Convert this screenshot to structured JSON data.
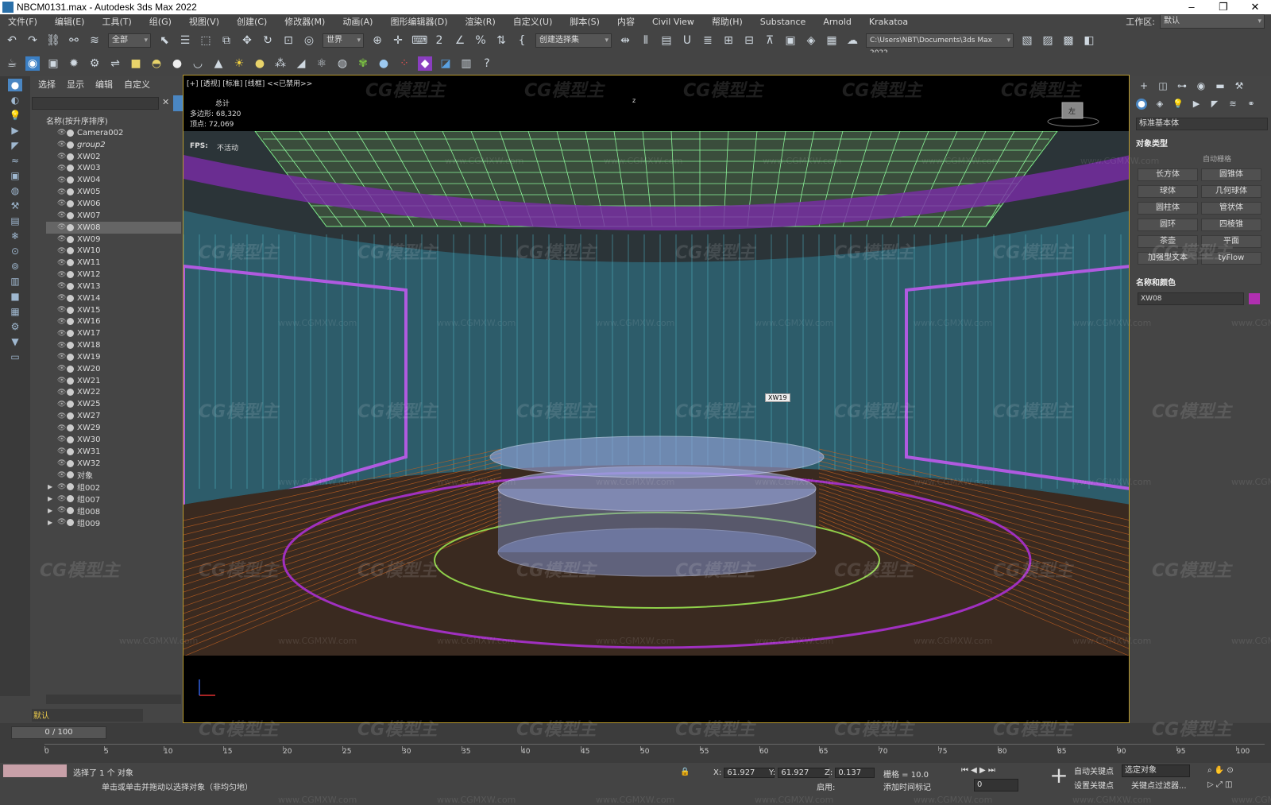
{
  "window": {
    "title": "NBCM0131.max - Autodesk 3ds Max 2022",
    "minimize": "–",
    "restore": "❐",
    "close": "✕"
  },
  "menu": {
    "items": [
      "文件(F)",
      "编辑(E)",
      "工具(T)",
      "组(G)",
      "视图(V)",
      "创建(C)",
      "修改器(M)",
      "动画(A)",
      "图形编辑器(D)",
      "渲染(R)",
      "自定义(U)",
      "脚本(S)",
      "内容",
      "Civil View",
      "帮助(H)",
      "Substance",
      "Arnold",
      "Krakatoa"
    ],
    "workspace_label": "工作区:",
    "workspace_value": "默认"
  },
  "toolbar": {
    "filter_dropdown": "全部",
    "coord_dropdown": "世界",
    "selection_set": "创建选择集",
    "project_path": "C:\\Users\\NBT\\Documents\\3ds Max 2022"
  },
  "scene_explorer": {
    "tabs": [
      "选择",
      "显示",
      "编辑",
      "自定义"
    ],
    "column_header": "名称(按升序排序)",
    "rows": [
      {
        "label": "Camera002"
      },
      {
        "label": "group2",
        "italic": true
      },
      {
        "label": "XW02"
      },
      {
        "label": "XW03"
      },
      {
        "label": "XW04"
      },
      {
        "label": "XW05"
      },
      {
        "label": "XW06"
      },
      {
        "label": "XW07"
      },
      {
        "label": "XW08",
        "selected": true
      },
      {
        "label": "XW09"
      },
      {
        "label": "XW10"
      },
      {
        "label": "XW11"
      },
      {
        "label": "XW12"
      },
      {
        "label": "XW13"
      },
      {
        "label": "XW14"
      },
      {
        "label": "XW15"
      },
      {
        "label": "XW16"
      },
      {
        "label": "XW17"
      },
      {
        "label": "XW18"
      },
      {
        "label": "XW19"
      },
      {
        "label": "XW20"
      },
      {
        "label": "XW21"
      },
      {
        "label": "XW22"
      },
      {
        "label": "XW25"
      },
      {
        "label": "XW27"
      },
      {
        "label": "XW29"
      },
      {
        "label": "XW30"
      },
      {
        "label": "XW31"
      },
      {
        "label": "XW32"
      },
      {
        "label": "对象"
      },
      {
        "label": "组002",
        "group": true
      },
      {
        "label": "组007",
        "group": true
      },
      {
        "label": "组008",
        "group": true
      },
      {
        "label": "组009",
        "group": true
      }
    ],
    "layer_value": "默认"
  },
  "viewport": {
    "label": "[+] [透视] [标准] [线框] <<已禁用>>",
    "stats_title": "总计",
    "poly_label": "多边形:",
    "poly_value": "68,320",
    "vert_label": "顶点:",
    "vert_value": "72,069",
    "fps_label": "FPS:",
    "fps_value": "不活动",
    "object_tag": "XW19",
    "axis_label": "z",
    "viewcube_label": "左"
  },
  "command_panel": {
    "category_dropdown": "标准基本体",
    "object_type_title": "对象类型",
    "autogrid": "自动栅格",
    "primitives": [
      "长方体",
      "圆锥体",
      "球体",
      "几何球体",
      "圆柱体",
      "管状体",
      "圆环",
      "四棱锥",
      "茶壶",
      "平面",
      "加强型文本",
      "tyFlow"
    ],
    "name_color_title": "名称和颜色",
    "name_value": "XW08",
    "color": "#b02fb0"
  },
  "timeline": {
    "slider": "0 / 100",
    "ticks": [
      "0",
      "5",
      "10",
      "15",
      "20",
      "25",
      "30",
      "35",
      "40",
      "45",
      "50",
      "55",
      "60",
      "65",
      "70",
      "75",
      "80",
      "85",
      "90",
      "95",
      "100"
    ]
  },
  "status": {
    "selected": "选择了 1 个 对象",
    "hint": "单击或单击并拖动以选择对象（非均匀地）",
    "x_label": "X:",
    "x_value": "61.927",
    "y_label": "Y:",
    "y_value": "61.927",
    "z_label": "Z:",
    "z_value": "0.137",
    "grid_label": "栅格 = 10.0",
    "auto_key": "自动关键点",
    "set_key": "设置关键点",
    "selected_object": "选定对象",
    "key_filters": "关键点过滤器...",
    "frame_value": "0",
    "enabled": "启用:",
    "add_time_tag": "添加时间标记"
  },
  "watermark": {
    "brand": "CG模型主",
    "url": "www.CGMXW.com"
  }
}
